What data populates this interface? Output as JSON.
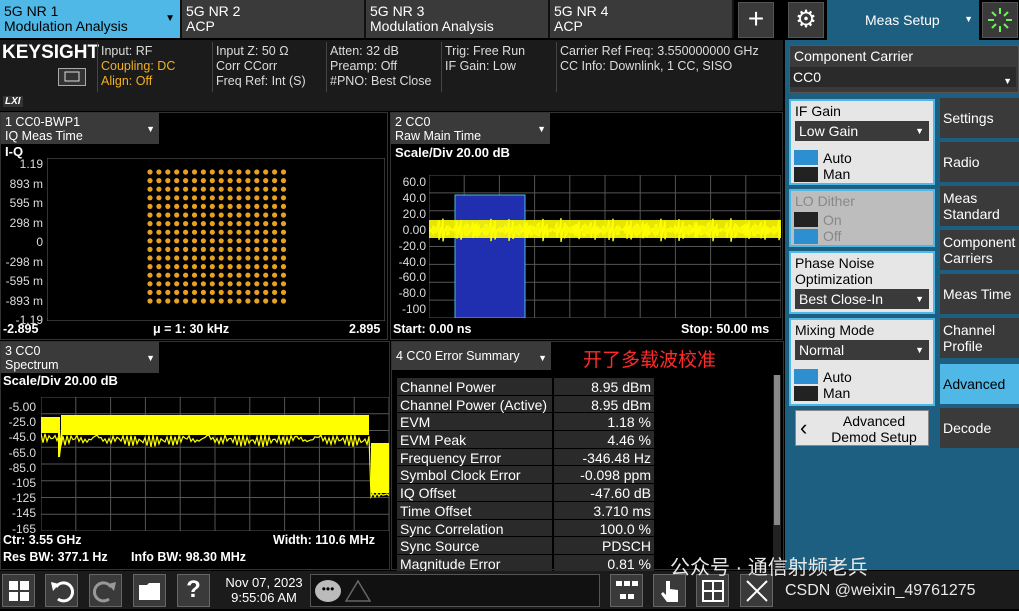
{
  "tabs": [
    {
      "line1": "5G NR 1",
      "line2": "Modulation Analysis",
      "active": true
    },
    {
      "line1": "5G NR 2",
      "line2": "ACP"
    },
    {
      "line1": "5G NR 3",
      "line2": "Modulation Analysis"
    },
    {
      "line1": "5G NR 4",
      "line2": "ACP"
    }
  ],
  "toolbar": {
    "add": "+",
    "menu_label": "Meas Setup"
  },
  "brand": "KEYSIGHT",
  "lxi": "LXI",
  "info": {
    "c1": [
      "Input: RF",
      "Coupling: DC",
      "Align: Off"
    ],
    "c2": [
      "Input Z: 50 Ω",
      "Corr CCorr",
      "Freq Ref: Int (S)"
    ],
    "c3": [
      "Atten: 32 dB",
      "Preamp: Off",
      "#PNO: Best Close"
    ],
    "c4": [
      "Trig: Free Run",
      "IF Gain: Low"
    ],
    "c5": [
      "Carrier Ref Freq: 3.550000000 GHz",
      "CC Info: Downlink, 1 CC, SISO"
    ]
  },
  "win1": {
    "l1": "1 CC0-BWP1",
    "l2": "IQ Meas Time",
    "label": "I-Q",
    "yticks": [
      "1.19",
      "893 m",
      "595 m",
      "298 m",
      "0",
      "-298 m",
      "-595 m",
      "-893 m",
      "-1.19"
    ],
    "xleft": "-2.895",
    "xmid": "μ = 1: 30 kHz",
    "xright": "2.895"
  },
  "win2": {
    "l1": "2 CC0",
    "l2": "Raw Main Time",
    "scale": "Scale/Div 20.00 dB",
    "yticks": [
      "60.0",
      "40.0",
      "20.0",
      "0.00",
      "-20.0",
      "-40.0",
      "-60.0",
      "-80.0",
      "-100"
    ],
    "start": "Start: 0.00 ns",
    "stop": "Stop: 50.00 ms"
  },
  "win3": {
    "l1": "3 CC0",
    "l2": "Spectrum",
    "scale": "Scale/Div 20.00 dB",
    "yticks": [
      "-5.00",
      "-25.0",
      "-45.0",
      "-65.0",
      "-85.0",
      "-105",
      "-125",
      "-145",
      "-165"
    ],
    "ctr": "Ctr: 3.55 GHz",
    "width": "Width: 110.6 MHz",
    "res": "Res BW: 377.1 Hz",
    "info": "Info BW: 98.30 MHz"
  },
  "win4": {
    "l1": "4 CC0 Error Summary",
    "annotation": "开了多载波校准",
    "rows": [
      [
        "Channel Power",
        "8.95 dBm"
      ],
      [
        "Channel Power (Active)",
        "8.95 dBm"
      ],
      [
        "EVM",
        "1.18 %"
      ],
      [
        "EVM Peak",
        "4.46 %"
      ],
      [
        "Frequency Error",
        "-346.48 Hz"
      ],
      [
        "Symbol Clock Error",
        "-0.098 ppm"
      ],
      [
        "IQ Offset",
        "-47.60 dB"
      ],
      [
        "Time Offset",
        "3.710 ms"
      ],
      [
        "Sync Correlation",
        "100.0 %"
      ],
      [
        "Sync Source",
        "PDSCH DMRS"
      ],
      [
        "Magnitude Error",
        "0.81 %"
      ]
    ]
  },
  "panel": {
    "cc_label": "Component Carrier",
    "cc_value": "CC0",
    "if_gain": "IF Gain",
    "if_value": "Low Gain",
    "auto": "Auto",
    "man": "Man",
    "lo": "LO Dither",
    "on": "On",
    "off": "Off",
    "pn": "Phase Noise Optimization",
    "pn_value": "Best Close-In",
    "mix": "Mixing Mode",
    "mix_value": "Normal",
    "adv1": "Advanced",
    "adv2": "Demod Setup"
  },
  "softkeys": [
    "Settings",
    "Radio",
    "Meas Standard",
    "Component Carriers",
    "Meas Time",
    "Channel Profile",
    "Advanced",
    "Decode"
  ],
  "status": {
    "date": "Nov 07, 2023",
    "time": "9:55:06 AM"
  },
  "watermark": {
    "wechat": "公众号 · 通信射频老兵",
    "csdn": "CSDN @weixin_49761275"
  },
  "colors": {
    "trace": "#ffff00",
    "accent": "#4fb8e6",
    "iq_points": "#e8a020",
    "annotation": "#ff2a2a"
  }
}
